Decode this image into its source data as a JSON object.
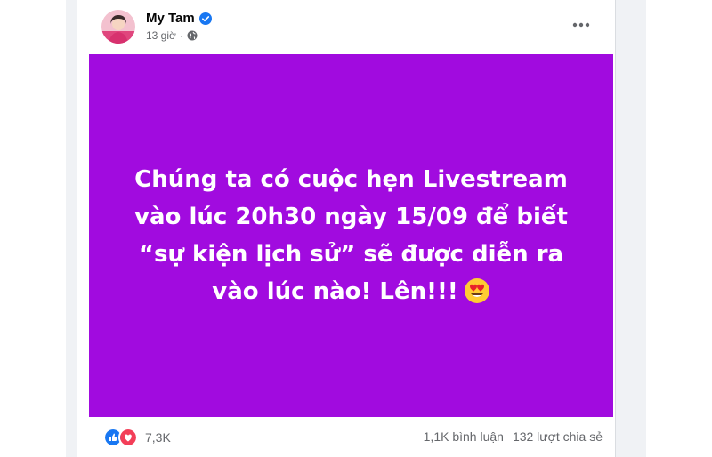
{
  "post": {
    "author": "My Tam",
    "time": "13 giờ",
    "separator": "·",
    "media_text": "Chúng ta có cuộc hẹn Livestream vào lúc 20h30 ngày 15/09 để biết “sự kiện lịch sử” sẽ được diễn ra vào lúc nào! Lên!!!",
    "media_color": "#a10bdf"
  },
  "reactions": {
    "icons": [
      "like-icon",
      "love-icon"
    ],
    "count": "7,3K"
  },
  "stats": {
    "comments": "1,1K bình luận",
    "shares": "132 lượt chia sẻ"
  }
}
